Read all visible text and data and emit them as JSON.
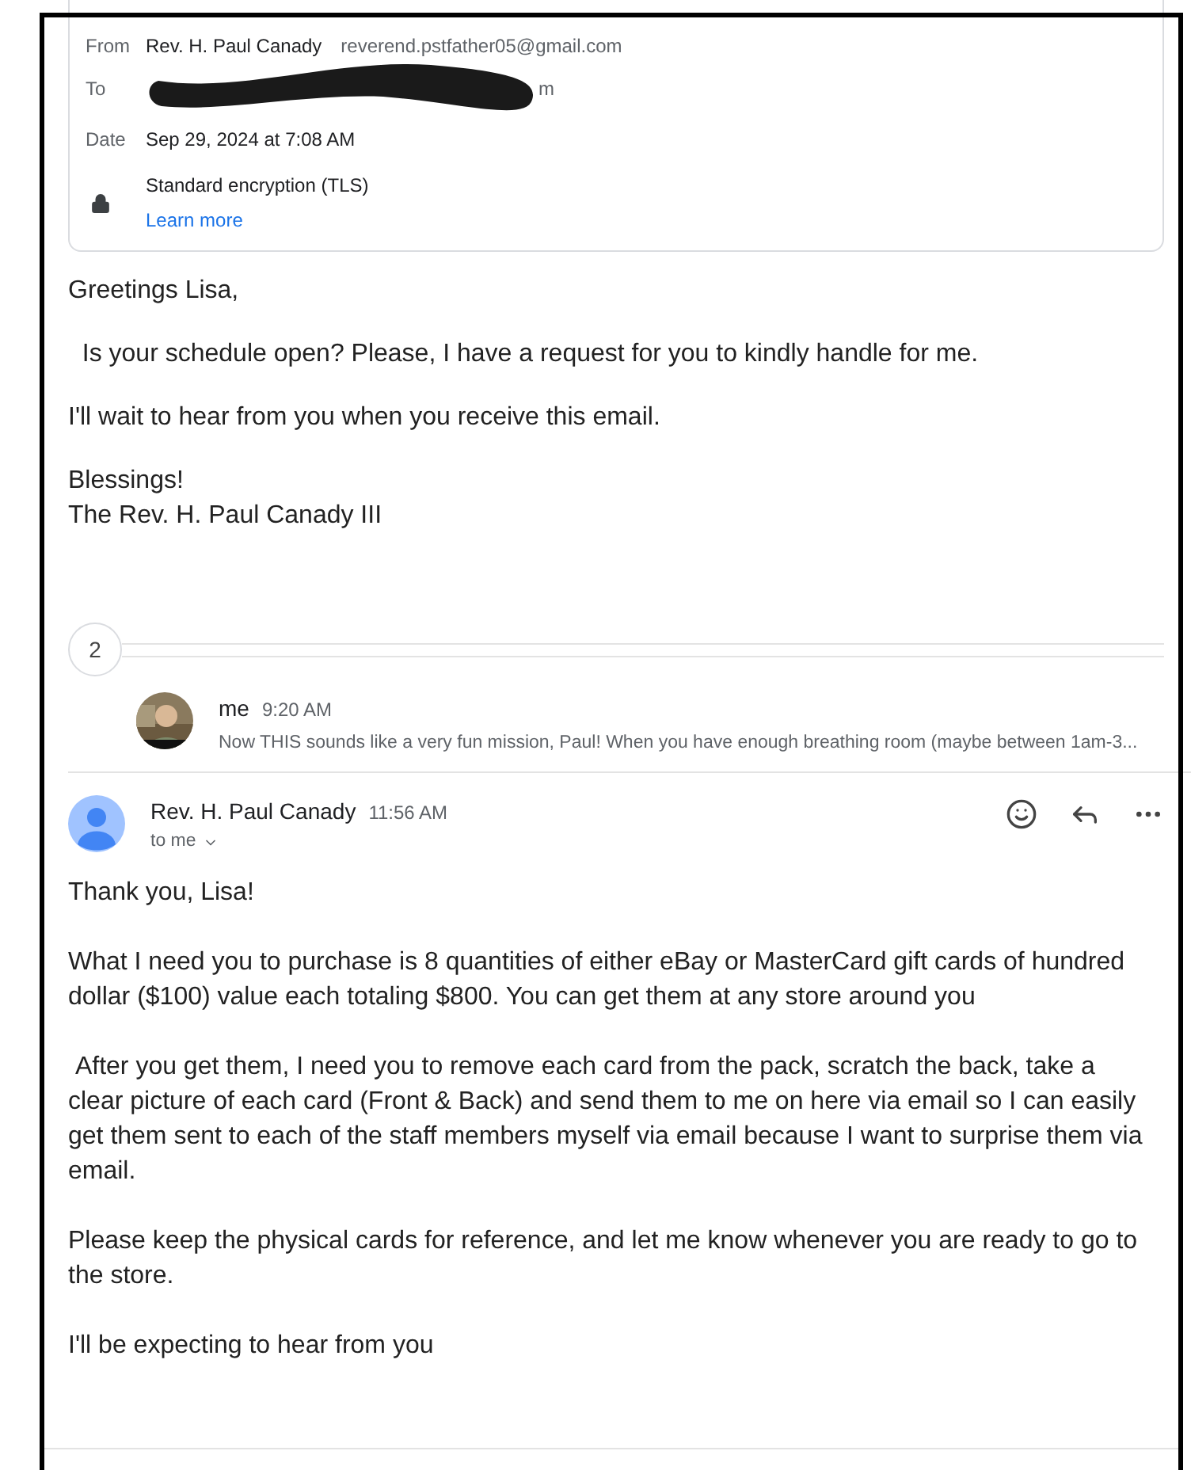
{
  "details": {
    "from_label": "From",
    "from_name": "Rev. H. Paul Canady",
    "from_email": "reverend.pstfather05@gmail.com",
    "to_label": "To",
    "to_visible": "m",
    "date_label": "Date",
    "date": "Sep 29, 2024 at 7:08 AM",
    "encryption": "Standard encryption (TLS)",
    "learn_more": "Learn more"
  },
  "first_message": [
    "Greetings Lisa,",
    "  Is your schedule open? Please, I have a request for you to kindly handle for me.",
    "I'll wait to hear from you when you receive this email.",
    "Blessings!\nThe Rev. H. Paul Canady III"
  ],
  "collapsed_count": "2",
  "collapsed_message": {
    "sender": "me",
    "time": "9:20 AM",
    "snippet": "Now THIS sounds like a very fun mission, Paul! When you have enough breathing room (maybe between 1am-3..."
  },
  "open_message": {
    "sender": "Rev. H. Paul Canady",
    "time": "11:56 AM",
    "recipient": "to me",
    "body": [
      "Thank you, Lisa!",
      "What I need you to purchase is 8 quantities of either eBay or MasterCard gift cards of hundred dollar ($100) value each totaling $800. You can get them at any store around you",
      " After you get them, I need you to remove each card from the pack, scratch the back, take a clear picture of each card (Front & Back) and send them to me on here via email so I can easily get them sent to each of the staff members myself via email because I want to surprise them via email.",
      "Please keep the physical cards for reference, and let me know whenever you are ready to go to the store.",
      "I'll be expecting to hear from you"
    ]
  }
}
